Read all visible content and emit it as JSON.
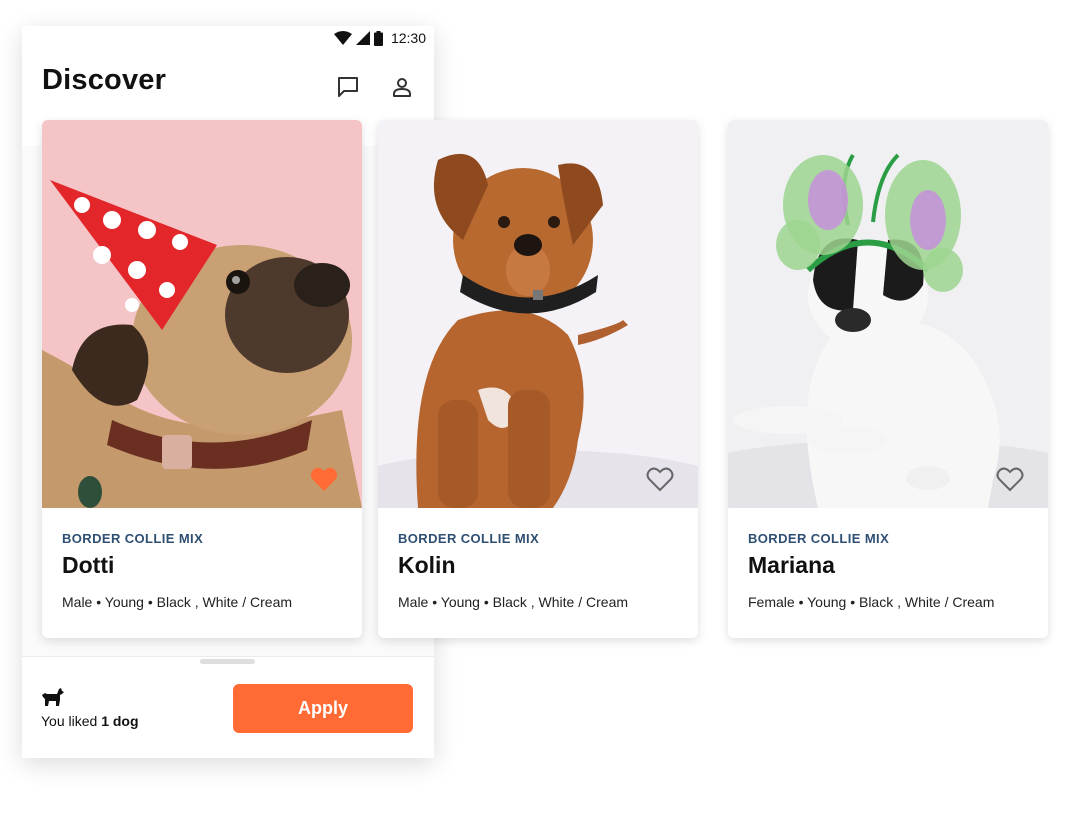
{
  "status": {
    "time": "12:30"
  },
  "header": {
    "title": "Discover",
    "messages_icon": "chat-bubble-icon",
    "profile_icon": "person-icon"
  },
  "cards": [
    {
      "breed": "BORDER COLLIE MIX",
      "name": "Dotti",
      "details": "Male • Young • Black , White / Cream",
      "liked": true
    },
    {
      "breed": "BORDER COLLIE MIX",
      "name": "Kolin",
      "details": "Male • Young • Black , White / Cream",
      "liked": false
    },
    {
      "breed": "BORDER COLLIE MIX",
      "name": "Mariana",
      "details": "Female • Young • Black , White / Cream",
      "liked": false
    }
  ],
  "footer": {
    "liked_prefix": "You liked",
    "liked_count": "1 dog",
    "apply_label": "Apply",
    "dog_icon": "dog-icon"
  },
  "colors": {
    "accent": "#ff6a35",
    "breed_text": "#2f4f73",
    "heart_outline": "#666666"
  }
}
